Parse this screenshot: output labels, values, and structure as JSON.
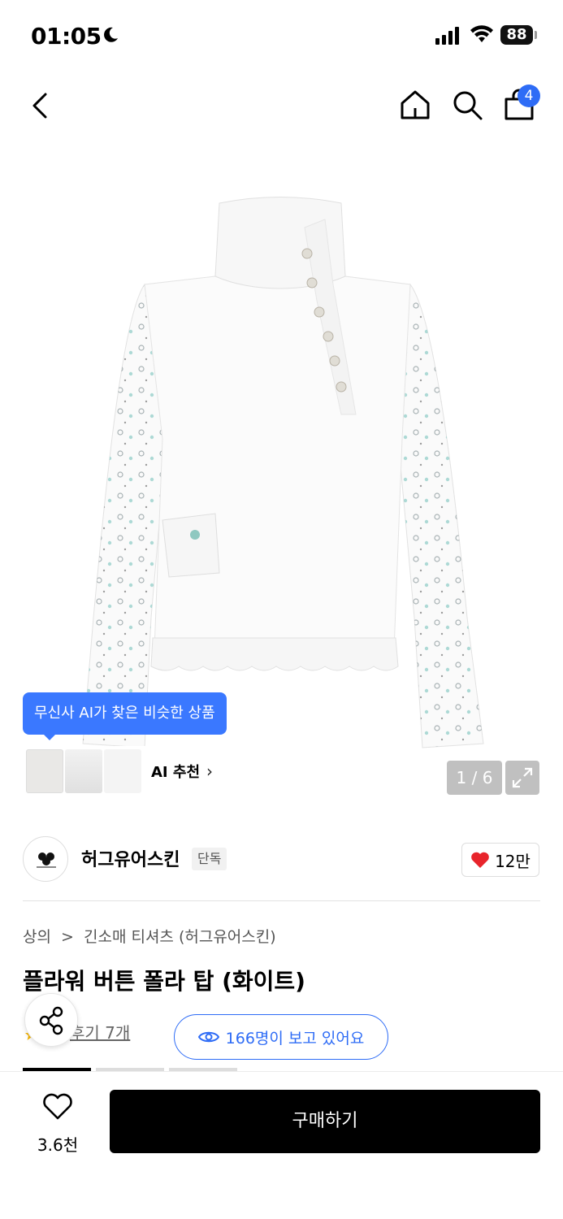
{
  "status_bar": {
    "time": "01:05",
    "battery": "88",
    "icons": [
      "moon-icon",
      "signal-icon",
      "wifi-icon",
      "battery-icon"
    ]
  },
  "nav": {
    "icons": [
      "back-icon",
      "home-icon",
      "search-icon",
      "cart-icon"
    ],
    "cart_badge": "4"
  },
  "gallery": {
    "ai_tooltip": "무신사 AI가 찾은 비슷한 상품",
    "ai_recommend_label": "AI 추천",
    "page_indicator": "1 / 6"
  },
  "brand": {
    "name": "허그유어스킨",
    "tag": "단독",
    "logo_text": "hugyourskin",
    "likes": "12만"
  },
  "breadcrumb": {
    "level1": "상의",
    "separator": ">",
    "level2": "긴소매 티셔츠 (허그유어스킨)"
  },
  "product": {
    "title": "플라워 버튼 폴라 탑 (화이트)",
    "review_link": "후기 7개",
    "viewers": "166명이 보고 있어요"
  },
  "bottom_bar": {
    "wish_count": "3.6천",
    "buy_label": "구매하기"
  },
  "colors": {
    "accent_blue": "#2e6cf6",
    "tooltip_blue": "#3a78ff",
    "like_red": "#e8242b",
    "buy_black": "#000000"
  }
}
